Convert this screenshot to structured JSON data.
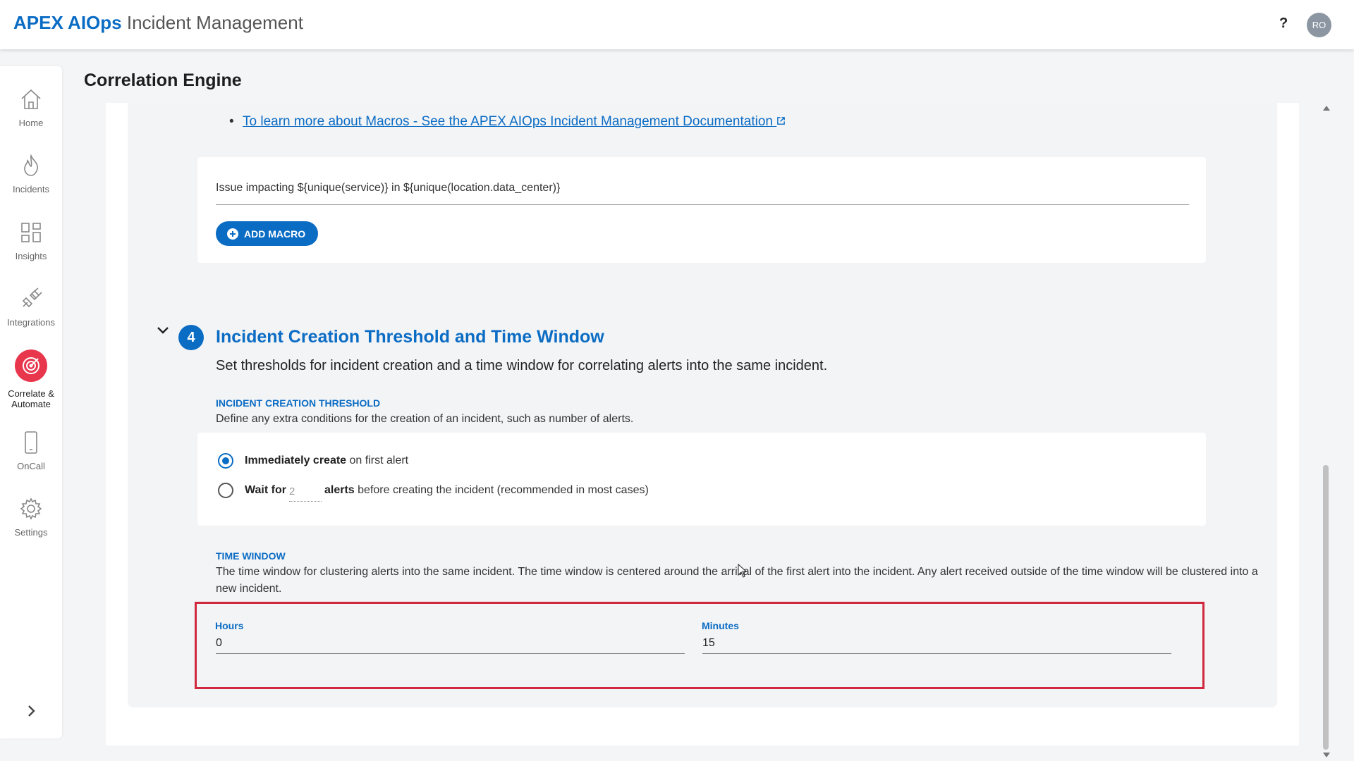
{
  "app": {
    "title_strong": "APEX AIOps",
    "title_rest": "Incident Management"
  },
  "header": {
    "help_label": "?",
    "avatar_initials": "RO"
  },
  "sidebar": {
    "items": [
      {
        "label": "Home",
        "icon": "home-icon"
      },
      {
        "label": "Incidents",
        "icon": "flame-icon"
      },
      {
        "label": "Insights",
        "icon": "grid-icon"
      },
      {
        "label": "Integrations",
        "icon": "plug-icon"
      },
      {
        "label": "Correlate &\nAutomate",
        "icon": "target-icon"
      },
      {
        "label": "OnCall",
        "icon": "phone-icon"
      },
      {
        "label": "Settings",
        "icon": "gear-icon"
      }
    ]
  },
  "page": {
    "title": "Correlation Engine"
  },
  "macros": {
    "doc_link": "To learn more about Macros - See the APEX AIOps Incident Management Documentation",
    "template_text": "Issue impacting  ${unique(service)} in  ${unique(location.data_center)}",
    "add_button": "ADD MACRO"
  },
  "section4": {
    "step": "4",
    "title": "Incident Creation Threshold and Time Window",
    "description": "Set thresholds for incident creation and a time window for correlating alerts into the same incident.",
    "threshold": {
      "title": "INCIDENT CREATION THRESHOLD",
      "description": "Define any extra conditions for the creation of an incident, such as number of alerts.",
      "option1_bold": "Immediately create",
      "option1_rest": " on first alert",
      "option2_bold_a": "Wait for",
      "option2_value": "2",
      "option2_bold_b": "alerts",
      "option2_rest": " before creating the incident (recommended in most cases)"
    },
    "time_window": {
      "title": "TIME WINDOW",
      "description": "The time window for clustering alerts into the same incident. The time window is centered around the arrival of the first alert into the incident. Any alert received outside of the time window will be clustered into a new incident.",
      "hours_label": "Hours",
      "hours_value": "0",
      "minutes_label": "Minutes",
      "minutes_value": "15"
    }
  },
  "colors": {
    "accent": "#0b6cc4",
    "highlight": "#d0283d",
    "correlate": "#e8364d"
  }
}
